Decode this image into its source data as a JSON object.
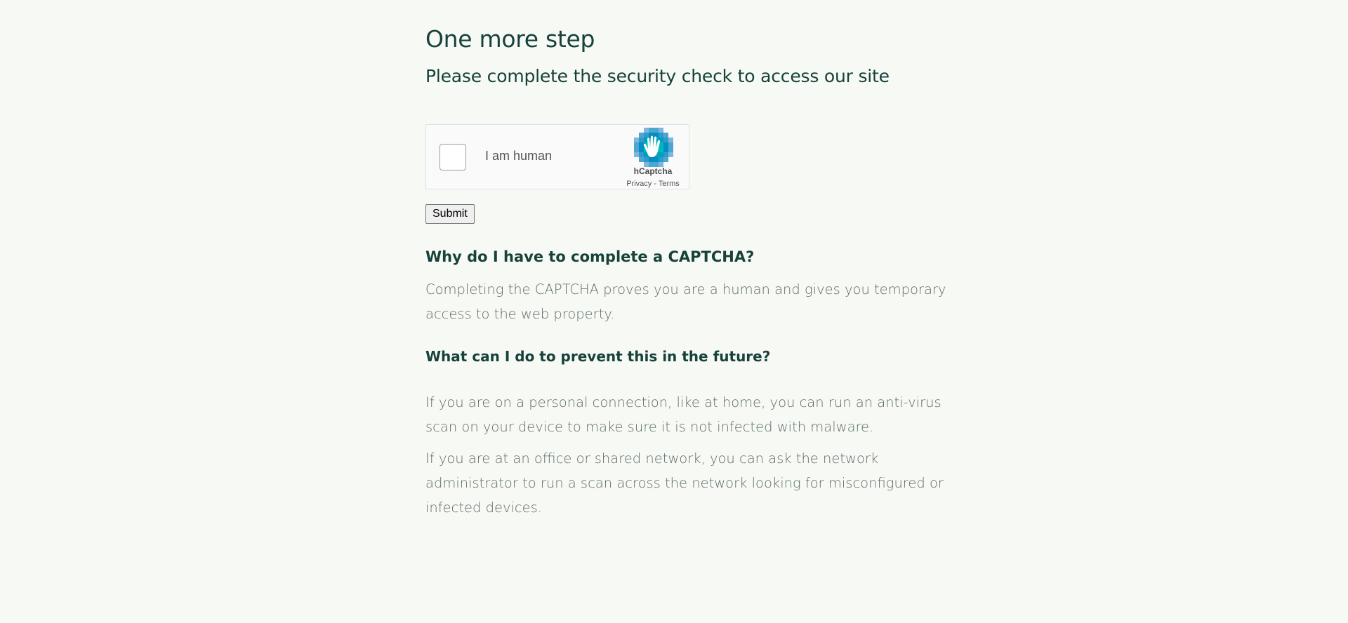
{
  "heading": "One more step",
  "subheading": "Please complete the security check to access our site",
  "captcha": {
    "checkbox_label": "I am human",
    "brand": "hCaptcha",
    "privacy_link": "Privacy",
    "separator": " - ",
    "terms_link": "Terms",
    "accent_color": "#1fa6c4"
  },
  "submit_label": "Submit",
  "faq": [
    {
      "question": "Why do I have to complete a CAPTCHA?",
      "answer": "Completing the CAPTCHA proves you are a human and gives you temporary access to the web property."
    },
    {
      "question": "What can I do to prevent this in the future?",
      "answers": [
        "If you are on a personal connection, like at home, you can run an anti-virus scan on your device to make sure it is not infected with malware.",
        "If you are at an office or shared network, you can ask the network administrator to run a scan across the network looking for misconfigured or infected devices."
      ]
    }
  ],
  "colors": {
    "background": "#f7faf4",
    "heading": "#17413b",
    "body_text": "#5c6b6a"
  }
}
